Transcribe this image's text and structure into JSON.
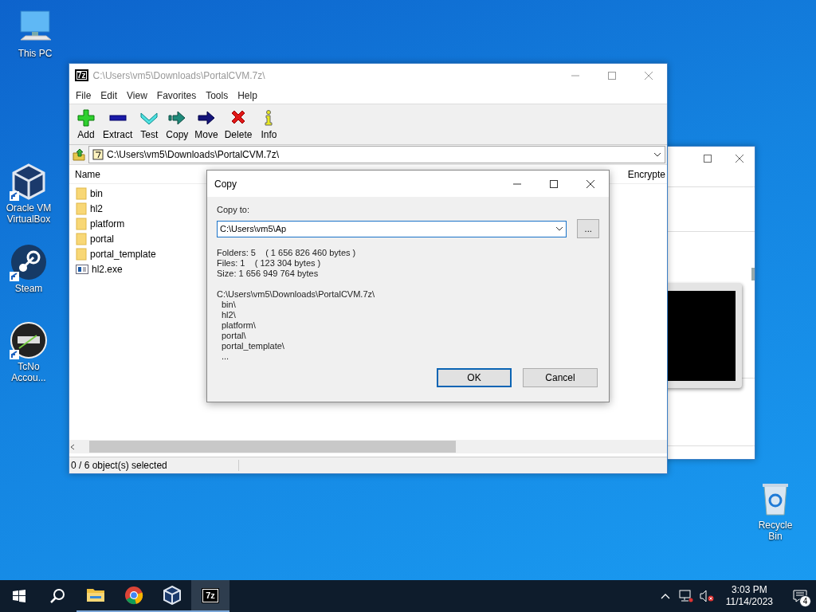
{
  "desktop_icons": [
    {
      "kind": "pc",
      "label": "This PC",
      "shortcut": false
    },
    {
      "kind": "virtualbox",
      "label": "Oracle VM VirtualBox",
      "shortcut": true
    },
    {
      "kind": "steam",
      "label": "Steam",
      "shortcut": true
    },
    {
      "kind": "tcno",
      "label": "TcNo Accou...",
      "shortcut": true
    },
    {
      "kind": "recycle",
      "label": "Recycle Bin",
      "shortcut": false
    }
  ],
  "main_window": {
    "logo": "7z",
    "title": "C:\\Users\\vm5\\Downloads\\PortalCVM.7z\\",
    "menu": [
      "File",
      "Edit",
      "View",
      "Favorites",
      "Tools",
      "Help"
    ],
    "toolbar": [
      {
        "kind": "add",
        "label": "Add"
      },
      {
        "kind": "extract",
        "label": "Extract"
      },
      {
        "kind": "test",
        "label": "Test"
      },
      {
        "kind": "copy",
        "label": "Copy"
      },
      {
        "kind": "move",
        "label": "Move"
      },
      {
        "kind": "delete",
        "label": "Delete"
      },
      {
        "kind": "info",
        "label": "Info"
      }
    ],
    "address": "C:\\Users\\vm5\\Downloads\\PortalCVM.7z\\",
    "columns": [
      "Name",
      "Encrypte"
    ],
    "files": [
      {
        "kind": "folder",
        "name": "bin"
      },
      {
        "kind": "folder",
        "name": "hl2"
      },
      {
        "kind": "folder",
        "name": "platform"
      },
      {
        "kind": "folder",
        "name": "portal"
      },
      {
        "kind": "folder",
        "name": "portal_template"
      },
      {
        "kind": "exe",
        "name": "hl2.exe"
      }
    ],
    "status": "0 / 6 object(s) selected"
  },
  "dialog": {
    "title": "Copy",
    "label": "Copy to:",
    "value": "C:\\Users\\vm5\\Ap",
    "browse": "...",
    "info": [
      "Folders: 5    ( 1 656 826 460 bytes )",
      "Files: 1    ( 123 304 bytes )",
      "Size: 1 656 949 764 bytes"
    ],
    "path": "C:\\Users\\vm5\\Downloads\\PortalCVM.7z\\",
    "items": [
      "bin\\",
      "hl2\\",
      "platform\\",
      "portal\\",
      "portal_template\\",
      "..."
    ],
    "buttons": [
      {
        "label": "OK",
        "selected": true
      },
      {
        "label": "Cancel",
        "selected": false
      }
    ]
  },
  "taskbar": {
    "apps": [
      {
        "kind": "explorer",
        "running": true,
        "selected": false
      },
      {
        "kind": "chrome",
        "running": true,
        "selected": false
      },
      {
        "kind": "virtualbox",
        "running": true,
        "selected": false
      },
      {
        "kind": "sevenzip",
        "logo": "7z",
        "running": true,
        "selected": true
      }
    ],
    "time": "3:03 PM",
    "date": "11/14/2023",
    "notifications": "4"
  }
}
